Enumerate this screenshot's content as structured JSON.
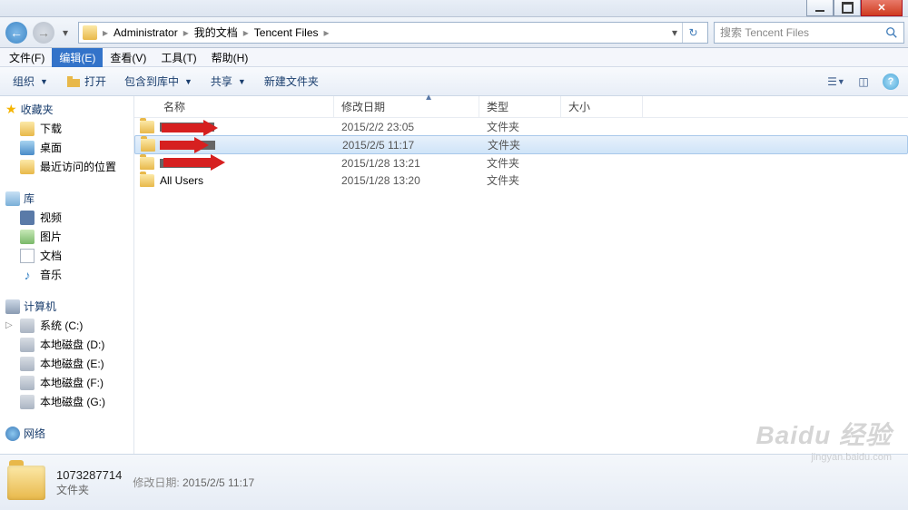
{
  "breadcrumb": {
    "p1": "Administrator",
    "p2": "我的文档",
    "p3": "Tencent Files"
  },
  "search": {
    "placeholder": "搜索 Tencent Files"
  },
  "menubar": {
    "file": "文件(F)",
    "edit": "编辑(E)",
    "view": "查看(V)",
    "tools": "工具(T)",
    "help": "帮助(H)"
  },
  "toolbar": {
    "organize": "组织",
    "open": "打开",
    "include": "包含到库中",
    "share": "共享",
    "newfolder": "新建文件夹"
  },
  "sidebar": {
    "favorites": "收藏夹",
    "downloads": "下载",
    "desktop": "桌面",
    "recent": "最近访问的位置",
    "libraries": "库",
    "videos": "视频",
    "pictures": "图片",
    "documents": "文档",
    "music": "音乐",
    "computer": "计算机",
    "sysdrive": "系统 (C:)",
    "drive_d": "本地磁盘 (D:)",
    "drive_e": "本地磁盘 (E:)",
    "drive_f": "本地磁盘 (F:)",
    "drive_g": "本地磁盘 (G:)",
    "network": "网络"
  },
  "columns": {
    "name": "名称",
    "date": "修改日期",
    "type": "类型",
    "size": "大小"
  },
  "rows": [
    {
      "name": "73102____",
      "redacted": true,
      "date": "2015/2/2 23:05",
      "type": "文件夹",
      "selected": false
    },
    {
      "name": "1073287714",
      "redacted": true,
      "date": "2015/2/5 11:17",
      "type": "文件夹",
      "selected": true
    },
    {
      "name": "253452____",
      "redacted": true,
      "date": "2015/1/28 13:21",
      "type": "文件夹",
      "selected": false
    },
    {
      "name": "All Users",
      "redacted": false,
      "date": "2015/1/28 13:20",
      "type": "文件夹",
      "selected": false
    }
  ],
  "details": {
    "name": "1073287714",
    "type": "文件夹",
    "date_label": "修改日期:",
    "date": "2015/2/5 11:17"
  },
  "watermark": {
    "brand": "Baidu 经验",
    "url": "jingyan.baidu.com"
  }
}
